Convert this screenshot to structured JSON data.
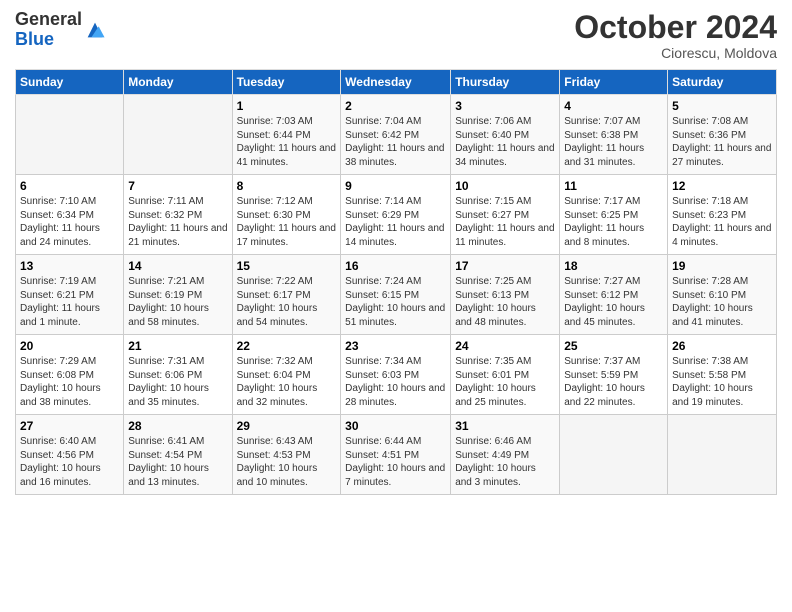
{
  "logo": {
    "general": "General",
    "blue": "Blue"
  },
  "title": "October 2024",
  "subtitle": "Ciorescu, Moldova",
  "headers": [
    "Sunday",
    "Monday",
    "Tuesday",
    "Wednesday",
    "Thursday",
    "Friday",
    "Saturday"
  ],
  "weeks": [
    [
      {
        "day": "",
        "info": ""
      },
      {
        "day": "",
        "info": ""
      },
      {
        "day": "1",
        "info": "Sunrise: 7:03 AM\nSunset: 6:44 PM\nDaylight: 11 hours and 41 minutes."
      },
      {
        "day": "2",
        "info": "Sunrise: 7:04 AM\nSunset: 6:42 PM\nDaylight: 11 hours and 38 minutes."
      },
      {
        "day": "3",
        "info": "Sunrise: 7:06 AM\nSunset: 6:40 PM\nDaylight: 11 hours and 34 minutes."
      },
      {
        "day": "4",
        "info": "Sunrise: 7:07 AM\nSunset: 6:38 PM\nDaylight: 11 hours and 31 minutes."
      },
      {
        "day": "5",
        "info": "Sunrise: 7:08 AM\nSunset: 6:36 PM\nDaylight: 11 hours and 27 minutes."
      }
    ],
    [
      {
        "day": "6",
        "info": "Sunrise: 7:10 AM\nSunset: 6:34 PM\nDaylight: 11 hours and 24 minutes."
      },
      {
        "day": "7",
        "info": "Sunrise: 7:11 AM\nSunset: 6:32 PM\nDaylight: 11 hours and 21 minutes."
      },
      {
        "day": "8",
        "info": "Sunrise: 7:12 AM\nSunset: 6:30 PM\nDaylight: 11 hours and 17 minutes."
      },
      {
        "day": "9",
        "info": "Sunrise: 7:14 AM\nSunset: 6:29 PM\nDaylight: 11 hours and 14 minutes."
      },
      {
        "day": "10",
        "info": "Sunrise: 7:15 AM\nSunset: 6:27 PM\nDaylight: 11 hours and 11 minutes."
      },
      {
        "day": "11",
        "info": "Sunrise: 7:17 AM\nSunset: 6:25 PM\nDaylight: 11 hours and 8 minutes."
      },
      {
        "day": "12",
        "info": "Sunrise: 7:18 AM\nSunset: 6:23 PM\nDaylight: 11 hours and 4 minutes."
      }
    ],
    [
      {
        "day": "13",
        "info": "Sunrise: 7:19 AM\nSunset: 6:21 PM\nDaylight: 11 hours and 1 minute."
      },
      {
        "day": "14",
        "info": "Sunrise: 7:21 AM\nSunset: 6:19 PM\nDaylight: 10 hours and 58 minutes."
      },
      {
        "day": "15",
        "info": "Sunrise: 7:22 AM\nSunset: 6:17 PM\nDaylight: 10 hours and 54 minutes."
      },
      {
        "day": "16",
        "info": "Sunrise: 7:24 AM\nSunset: 6:15 PM\nDaylight: 10 hours and 51 minutes."
      },
      {
        "day": "17",
        "info": "Sunrise: 7:25 AM\nSunset: 6:13 PM\nDaylight: 10 hours and 48 minutes."
      },
      {
        "day": "18",
        "info": "Sunrise: 7:27 AM\nSunset: 6:12 PM\nDaylight: 10 hours and 45 minutes."
      },
      {
        "day": "19",
        "info": "Sunrise: 7:28 AM\nSunset: 6:10 PM\nDaylight: 10 hours and 41 minutes."
      }
    ],
    [
      {
        "day": "20",
        "info": "Sunrise: 7:29 AM\nSunset: 6:08 PM\nDaylight: 10 hours and 38 minutes."
      },
      {
        "day": "21",
        "info": "Sunrise: 7:31 AM\nSunset: 6:06 PM\nDaylight: 10 hours and 35 minutes."
      },
      {
        "day": "22",
        "info": "Sunrise: 7:32 AM\nSunset: 6:04 PM\nDaylight: 10 hours and 32 minutes."
      },
      {
        "day": "23",
        "info": "Sunrise: 7:34 AM\nSunset: 6:03 PM\nDaylight: 10 hours and 28 minutes."
      },
      {
        "day": "24",
        "info": "Sunrise: 7:35 AM\nSunset: 6:01 PM\nDaylight: 10 hours and 25 minutes."
      },
      {
        "day": "25",
        "info": "Sunrise: 7:37 AM\nSunset: 5:59 PM\nDaylight: 10 hours and 22 minutes."
      },
      {
        "day": "26",
        "info": "Sunrise: 7:38 AM\nSunset: 5:58 PM\nDaylight: 10 hours and 19 minutes."
      }
    ],
    [
      {
        "day": "27",
        "info": "Sunrise: 6:40 AM\nSunset: 4:56 PM\nDaylight: 10 hours and 16 minutes."
      },
      {
        "day": "28",
        "info": "Sunrise: 6:41 AM\nSunset: 4:54 PM\nDaylight: 10 hours and 13 minutes."
      },
      {
        "day": "29",
        "info": "Sunrise: 6:43 AM\nSunset: 4:53 PM\nDaylight: 10 hours and 10 minutes."
      },
      {
        "day": "30",
        "info": "Sunrise: 6:44 AM\nSunset: 4:51 PM\nDaylight: 10 hours and 7 minutes."
      },
      {
        "day": "31",
        "info": "Sunrise: 6:46 AM\nSunset: 4:49 PM\nDaylight: 10 hours and 3 minutes."
      },
      {
        "day": "",
        "info": ""
      },
      {
        "day": "",
        "info": ""
      }
    ]
  ]
}
